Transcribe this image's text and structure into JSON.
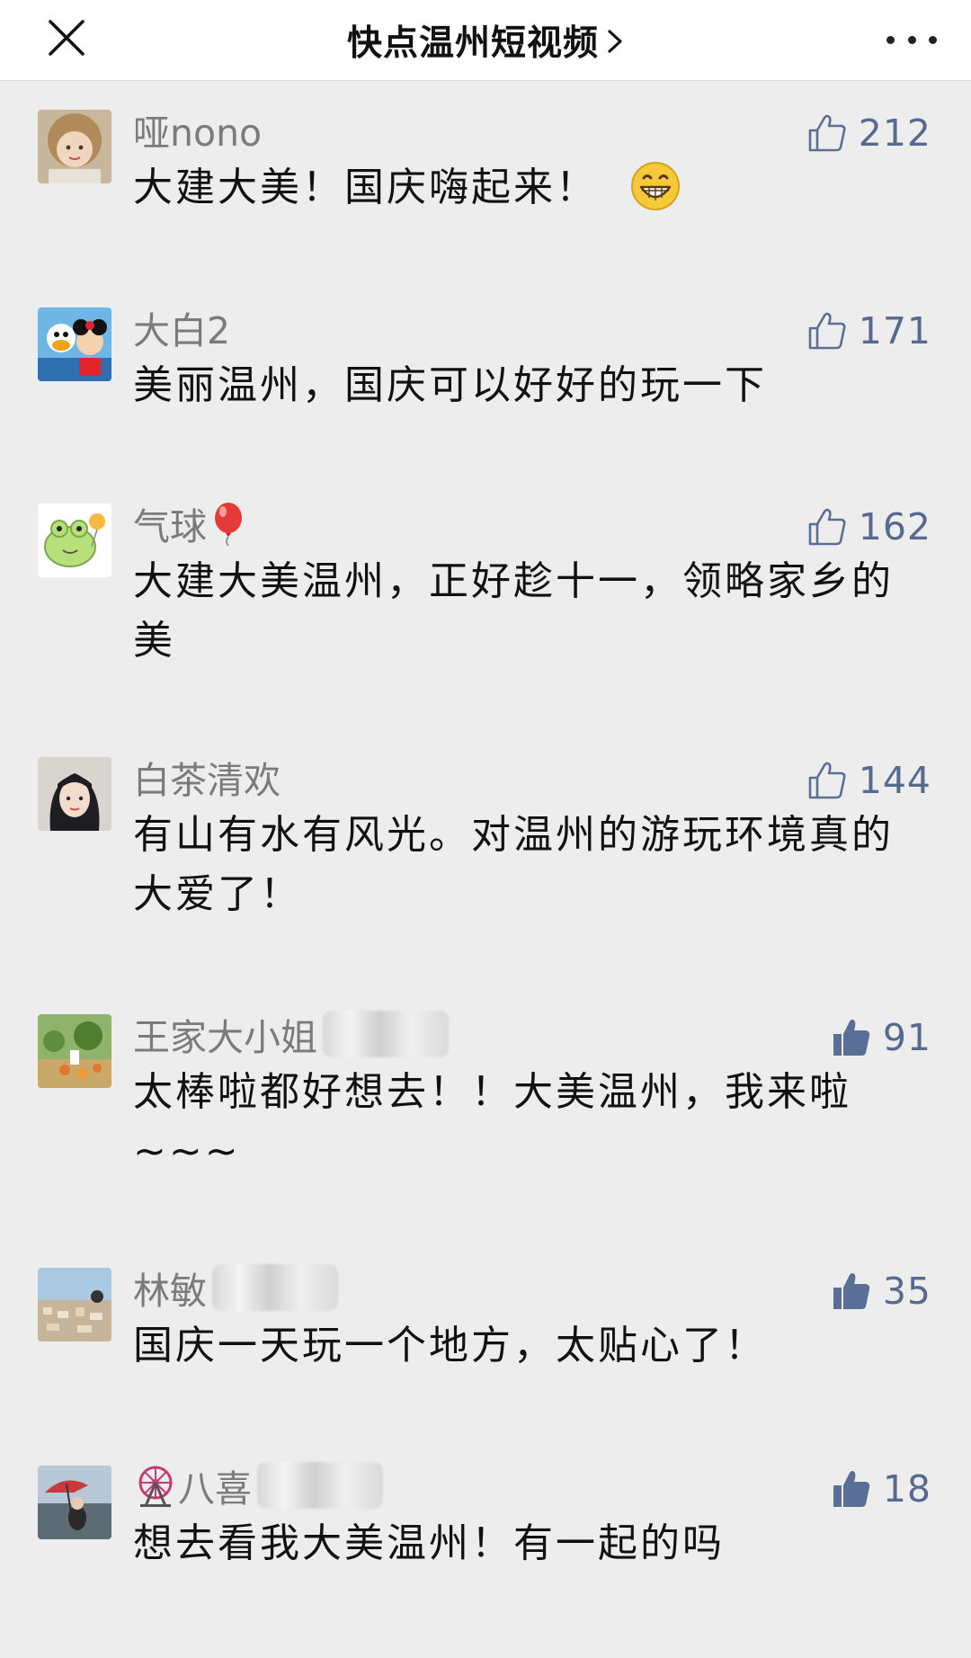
{
  "header": {
    "title": "快点温州短视频",
    "close_icon": "close-icon",
    "chevron_icon": "chevron-right-icon",
    "more_icon": "more-dots-icon"
  },
  "colors": {
    "username": "#7b7b7b",
    "like_count": "#566a8f",
    "thumb_filled": "#5a6f95",
    "background": "#ededed"
  },
  "comments": [
    {
      "username": "哑nono",
      "likes": "212",
      "text": "大建大美！国庆嗨起来！",
      "emoji": "grinning-face",
      "liked_icon": "thumbs-up-outline-icon"
    },
    {
      "username": "大白2",
      "likes": "171",
      "text": "美丽温州，国庆可以好好的玩一下",
      "liked_icon": "thumbs-up-outline-icon"
    },
    {
      "username": "气球",
      "name_emoji": "balloon",
      "likes": "162",
      "text": "大建大美温州，正好趁十一，领略家乡的美",
      "liked_icon": "thumbs-up-outline-icon"
    },
    {
      "username": "白茶清欢",
      "likes": "144",
      "text": "有山有水有风光。对温州的游玩环境真的大爱了！",
      "liked_icon": "thumbs-up-outline-icon"
    },
    {
      "username": "王家大小姐",
      "likes": "91",
      "text": "太棒啦都好想去！！大美温州，我来啦~~~",
      "liked_icon": "thumbs-up-filled-icon"
    },
    {
      "username": "林敏",
      "likes": "35",
      "text": "国庆一天玩一个地方，太贴心了！",
      "liked_icon": "thumbs-up-filled-icon"
    },
    {
      "username": "八喜",
      "name_emoji": "ferris-wheel",
      "likes": "18",
      "text": "想去看我大美温州！有一起的吗",
      "liked_icon": "thumbs-up-filled-icon"
    }
  ]
}
